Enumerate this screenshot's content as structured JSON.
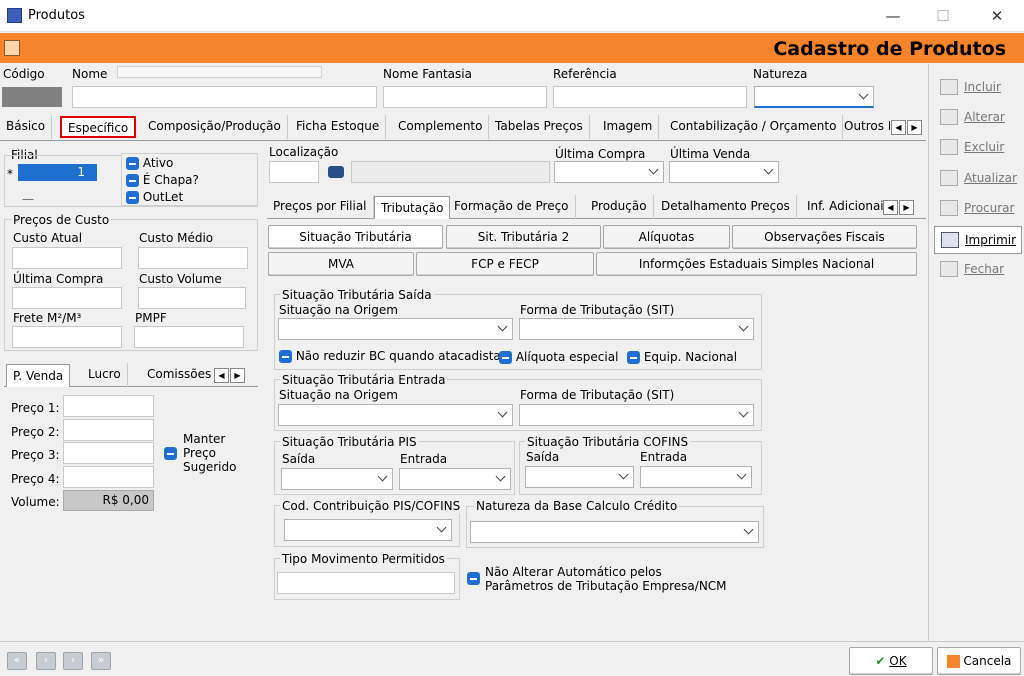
{
  "window": {
    "title": "Produtos",
    "minimize": "—",
    "maximize": "☐",
    "close": "✕"
  },
  "header": {
    "title": "Cadastro de Produtos"
  },
  "top_fields": {
    "codigo": "Código",
    "nome": "Nome",
    "nome_fantasia": "Nome Fantasia",
    "referencia": "Referência",
    "natureza": "Natureza"
  },
  "main_tabs": [
    "Básico",
    "Específico",
    "Composição/Produção",
    "Ficha Estoque",
    "Complemento",
    "Tabelas Preços",
    "Imagem",
    "Contabilização / Orçamento",
    "Outros N"
  ],
  "filial": {
    "label": "Filial",
    "star": "*",
    "value": "1",
    "dash": "—"
  },
  "checks": [
    "Ativo",
    "É Chapa?",
    "OutLet"
  ],
  "localizacao": {
    "label": "Localização",
    "ultima_compra": "Última Compra",
    "ultima_venda": "Última Venda"
  },
  "precos_custo": {
    "group": "Preços de Custo",
    "custo_atual": "Custo Atual",
    "custo_medio": "Custo Médio",
    "ultima_compra": "Última Compra",
    "custo_volume": "Custo Volume",
    "frete": "Frete M²/M³",
    "pmpf": "PMPF"
  },
  "sub_tabs_left": [
    "P. Venda",
    "Lucro",
    "Comissões"
  ],
  "precos": {
    "p1": "Preço 1:",
    "p2": "Preço 2:",
    "p3": "Preço 3:",
    "p4": "Preço 4:",
    "volume": "Volume:",
    "volume_value": "R$ 0,00",
    "manter": "Manter",
    "preco": "Preço",
    "sugerido": "Sugerido"
  },
  "sub_tabs_right": [
    "Preços por Filial",
    "Tributação",
    "Formação de Preço",
    "Produção",
    "Detalhamento Preços",
    "Inf. Adicionais"
  ],
  "trib_buttons_row1": [
    "Situação Tributária",
    "Sit. Tributária 2",
    "Alíquotas",
    "Observações Fiscais"
  ],
  "trib_buttons_row2": [
    "MVA",
    "FCP e FECP",
    "Informções Estaduais Simples Nacional"
  ],
  "saida": {
    "group": "Situação Tributária Saída",
    "origem": "Situação na Origem",
    "forma": "Forma de Tributação (SIT)",
    "cb1": "Não reduzir BC quando atacadista",
    "cb2": "Alíquota especial",
    "cb3": "Equip. Nacional"
  },
  "entrada": {
    "group": "Situação Tributária Entrada",
    "origem": "Situação na Origem",
    "forma": "Forma de Tributação (SIT)"
  },
  "pis": {
    "group": "Situação Tributária PIS",
    "saida": "Saída",
    "entrada": "Entrada"
  },
  "cofins": {
    "group": "Situação Tributária COFINS",
    "saida": "Saída",
    "entrada": "Entrada"
  },
  "cod_contrib": {
    "group": "Cod. Contribuição PIS/COFINS"
  },
  "natureza_base": {
    "group": "Natureza da Base Calculo Crédito"
  },
  "tipo_mov": {
    "group": "Tipo Movimento Permitidos"
  },
  "nao_alterar": {
    "line1": "Não Alterar Automático pelos",
    "line2": "Parâmetros de Tributação Empresa/NCM"
  },
  "right_buttons": [
    "Incluir",
    "Alterar",
    "Excluir",
    "Atualizar",
    "Procurar",
    "Imprimir",
    "Fechar"
  ],
  "bottom": {
    "ok": "OK",
    "cancela": "Cancela"
  }
}
